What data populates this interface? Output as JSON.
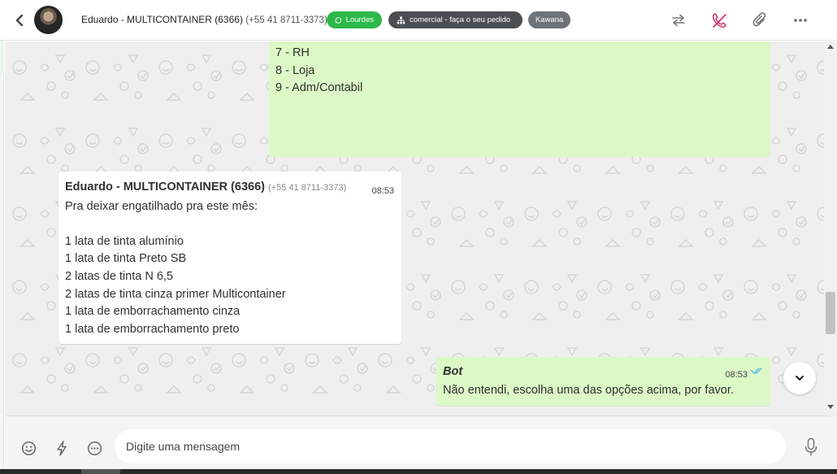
{
  "header": {
    "contact_name": "Eduardo - MULTICONTAINER (6366)",
    "contact_phone": "(+55 41 8711-3373)",
    "tags": [
      {
        "label": "Lourdes",
        "icon": "whatsapp-icon",
        "color": "#2fb84a"
      },
      {
        "label": "comercial - faça o seu pedido",
        "icon": "sitemap-icon",
        "color": "#4b4f52"
      },
      {
        "label": "Kawana",
        "color": "#6e7378"
      }
    ],
    "actions": [
      "transfer-icon",
      "end-call-icon",
      "attach-icon",
      "more-options-icon"
    ]
  },
  "messages": {
    "outgoing_top": {
      "lines": [
        "7 - RH",
        "8 - Loja",
        "9 - Adm/Contabil"
      ]
    },
    "incoming": {
      "sender": "Eduardo - MULTICONTAINER (6366)",
      "phone": "(+55 41 8711-3373)",
      "time": "08:53",
      "lines": [
        "Pra deixar engatilhado pra este mês:",
        "",
        "1 lata de tinta alumínio",
        "1 lata de tinta Preto SB",
        "2 latas de tinta N 6,5",
        "2 latas de tinta cinza primer Multicontainer",
        "1 lata de emborrachamento cinza",
        "1 lata de emborrachamento preto"
      ]
    },
    "bot": {
      "sender": "Bot",
      "time": "08:53",
      "text": "Não entendi, escolha uma das opções acima, por favor."
    }
  },
  "composer": {
    "placeholder": "Digite uma mensagem"
  },
  "colors": {
    "outgoing_bubble": "#dcf8c6",
    "incoming_bubble": "#ffffff",
    "chat_bg": "#efefef",
    "read_ticks": "#4fb6ec",
    "end_call": "#d6336c"
  }
}
